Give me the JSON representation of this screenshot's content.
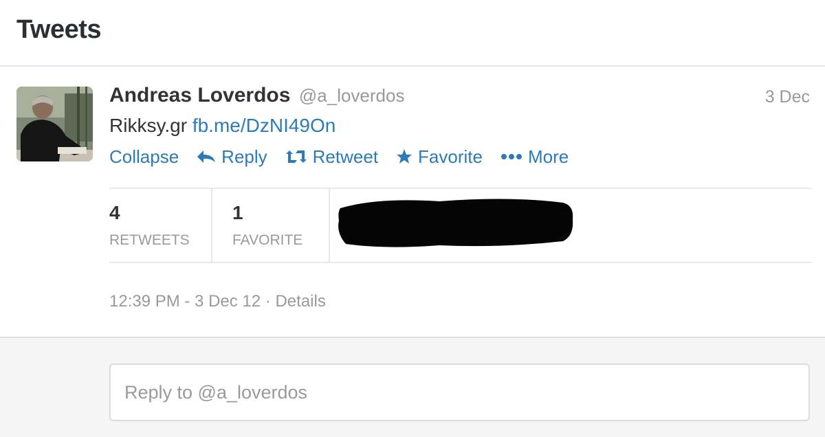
{
  "header": {
    "title": "Tweets"
  },
  "tweet": {
    "fullname": "Andreas Loverdos",
    "username": "@a_loverdos",
    "timestamp": "3 Dec",
    "text": "Rikksy.gr",
    "link": "fb.me/DzNI49On",
    "actions": {
      "collapse": "Collapse",
      "reply": "Reply",
      "retweet": "Retweet",
      "favorite": "Favorite",
      "more": "More"
    },
    "stats": {
      "retweets_count": "4",
      "retweets_label": "RETWEETS",
      "favorites_count": "1",
      "favorites_label": "FAVORITE"
    },
    "meta": {
      "datetime": "12:39 PM - 3 Dec 12",
      "separator": "·",
      "details": "Details"
    }
  },
  "reply": {
    "placeholder": "Reply to @a_loverdos"
  },
  "colors": {
    "link": "#2b7bb9",
    "muted": "#999999",
    "text": "#333333"
  },
  "icons": [
    "reply-icon",
    "retweet-icon",
    "star-icon",
    "more-dots-icon"
  ]
}
